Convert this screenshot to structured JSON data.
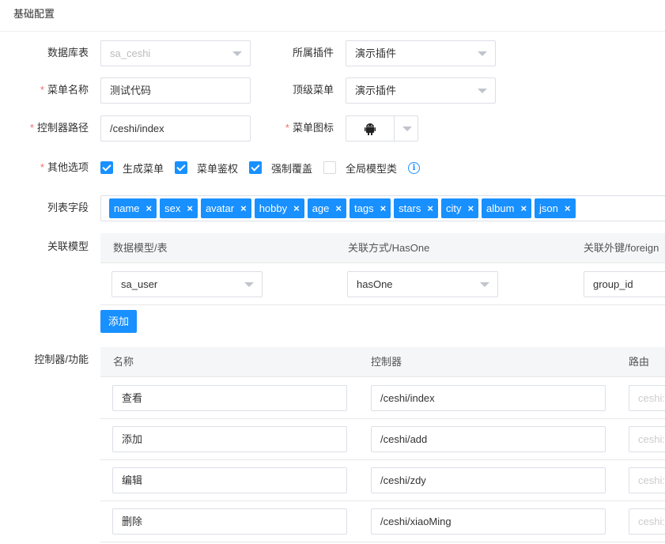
{
  "card": {
    "title": "基础配置"
  },
  "form": {
    "db_table": {
      "label": "数据库表",
      "value": "sa_ceshi"
    },
    "plugin": {
      "label": "所属插件",
      "value": "演示插件"
    },
    "menu_name": {
      "label": "菜单名称",
      "value": "测试代码"
    },
    "top_menu": {
      "label": "顶级菜单",
      "value": "演示插件"
    },
    "controller_path": {
      "label": "控制器路径",
      "value": "/ceshi/index"
    },
    "menu_icon": {
      "label": "菜单图标",
      "icon": "android-icon"
    },
    "options": {
      "label": "其他选项",
      "items": [
        {
          "label": "生成菜单",
          "checked": true
        },
        {
          "label": "菜单鉴权",
          "checked": true
        },
        {
          "label": "强制覆盖",
          "checked": true
        },
        {
          "label": "全局模型类",
          "checked": false
        }
      ]
    },
    "list_fields": {
      "label": "列表字段",
      "tags": [
        "name",
        "sex",
        "avatar",
        "hobby",
        "age",
        "tags",
        "stars",
        "city",
        "album",
        "json"
      ]
    },
    "relation": {
      "label": "关联模型",
      "headers": [
        "数据模型/表",
        "关联方式/HasOne",
        "关联外键/foreign"
      ],
      "row": {
        "model": "sa_user",
        "type": "hasOne",
        "foreign_key": "group_id"
      },
      "add_label": "添加"
    },
    "controller": {
      "label": "控制器/功能",
      "headers": [
        "名称",
        "控制器",
        "路由"
      ],
      "rows": [
        {
          "name": "查看",
          "controller": "/ceshi/index",
          "route": "ceshi:"
        },
        {
          "name": "添加",
          "controller": "/ceshi/add",
          "route": "ceshi:"
        },
        {
          "name": "编辑",
          "controller": "/ceshi/zdy",
          "route": "ceshi:"
        },
        {
          "name": "删除",
          "controller": "/ceshi/xiaoMing",
          "route": "ceshi:"
        }
      ]
    }
  },
  "colors": {
    "primary": "#1890ff",
    "required": "#f56c6c",
    "border": "#dcdfe6"
  }
}
